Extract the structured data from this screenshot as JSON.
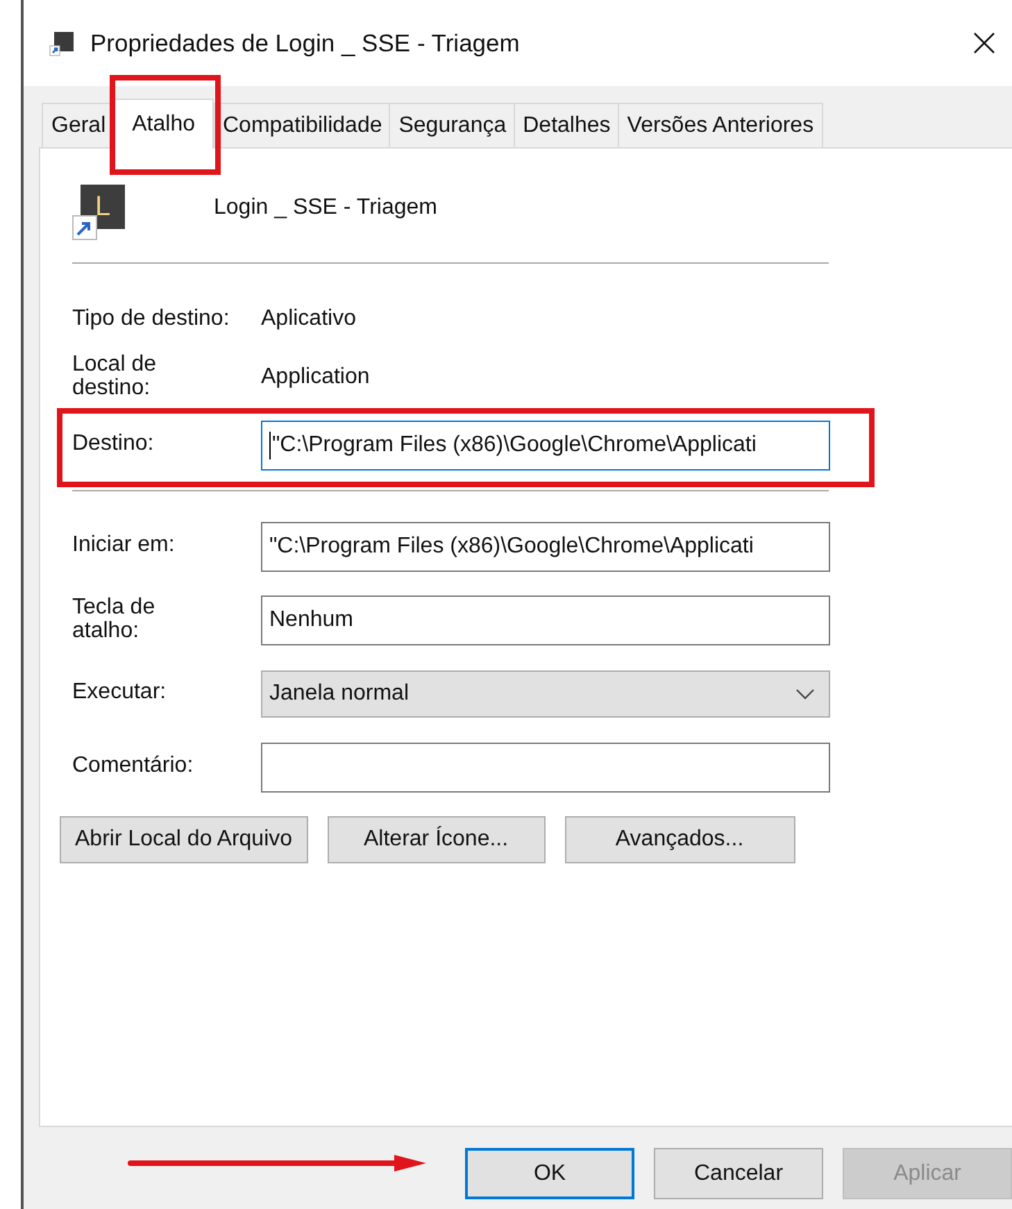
{
  "window": {
    "title": "Propriedades de Login _ SSE - Triagem"
  },
  "tabs": [
    {
      "label": "Geral",
      "selected": false
    },
    {
      "label": "Atalho",
      "selected": true
    },
    {
      "label": "Compatibilidade",
      "selected": false
    },
    {
      "label": "Segurança",
      "selected": false
    },
    {
      "label": "Detalhes",
      "selected": false
    },
    {
      "label": "Versões Anteriores",
      "selected": false
    }
  ],
  "shortcut": {
    "name": "Login _ SSE - Triagem",
    "icon_letter": "L"
  },
  "info": [
    {
      "label": "Tipo de destino:",
      "value": "Aplicativo"
    },
    {
      "label": "Local de destino:",
      "value": "Application"
    }
  ],
  "target": {
    "label": "Destino:",
    "value": "\"C:\\Program Files (x86)\\Google\\Chrome\\Applicati",
    "focused": true
  },
  "fields": [
    {
      "kind": "text",
      "label": "Iniciar em:",
      "value": "\"C:\\Program Files (x86)\\Google\\Chrome\\Applicati"
    },
    {
      "kind": "text",
      "label": "Tecla de atalho:",
      "value": "Nenhum"
    },
    {
      "kind": "dropdown",
      "label": "Executar:",
      "value": "Janela normal"
    },
    {
      "kind": "text",
      "label": "Comentário:"
    }
  ],
  "actions": [
    "Abrir Local do Arquivo",
    "Alterar Ícone...",
    "Avançados..."
  ],
  "dialog_buttons": [
    {
      "label": "OK",
      "default": true,
      "disabled": false
    },
    {
      "label": "Cancelar",
      "default": false,
      "disabled": false
    },
    {
      "label": "Aplicar",
      "default": false,
      "disabled": true
    }
  ]
}
